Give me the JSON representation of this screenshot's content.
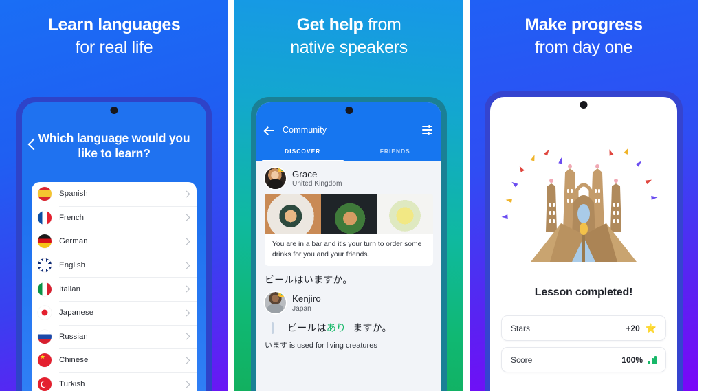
{
  "panels": [
    {
      "headline": {
        "bold": "Learn languages",
        "light": "",
        "line2": "for real life"
      },
      "screen": {
        "back_icon": "chevron-left-icon",
        "question": "Which language would you like to learn?",
        "languages": [
          {
            "name": "Spanish",
            "flag": "flag-spain"
          },
          {
            "name": "French",
            "flag": "flag-france"
          },
          {
            "name": "German",
            "flag": "flag-germany"
          },
          {
            "name": "English",
            "flag": "flag-uk"
          },
          {
            "name": "Italian",
            "flag": "flag-italy"
          },
          {
            "name": "Japanese",
            "flag": "flag-japan"
          },
          {
            "name": "Russian",
            "flag": "flag-russia"
          },
          {
            "name": "Chinese",
            "flag": "flag-china"
          },
          {
            "name": "Turkish",
            "flag": "flag-turkey"
          }
        ]
      }
    },
    {
      "headline": {
        "bold": "Get help",
        "light": " from",
        "line2": "native speakers"
      },
      "screen": {
        "back_icon": "arrow-left-icon",
        "title": "Community",
        "filter_icon": "sliders-icon",
        "tabs": [
          {
            "label": "DISCOVER",
            "active": true
          },
          {
            "label": "FRIENDS",
            "active": false
          }
        ],
        "post": {
          "author": "Grace",
          "location": "United Kingdom",
          "badge_icon": "crown-icon",
          "caption": "You are in a bar and it's your turn to order some drinks for you and your friends.",
          "body": "ビールはいますか。"
        },
        "reply": {
          "author": "Kenjiro",
          "location": "Japan",
          "badge_icon": "crown-icon",
          "correction_before": "ビールは",
          "correction_highlight": "あり",
          "correction_after": "ますか。",
          "note": "います is used for living creatures"
        }
      }
    },
    {
      "headline": {
        "bold": "Make progress",
        "light": "",
        "line2": "from day one"
      },
      "screen": {
        "illustration": "sagrada-familia-icon",
        "title": "Lesson completed!",
        "stats": [
          {
            "label": "Stars",
            "value": "+20",
            "icon": "star-icon"
          },
          {
            "label": "Score",
            "value": "100%",
            "icon": "bar-chart-icon"
          }
        ]
      }
    }
  ],
  "colors": {
    "panel1_start": "#1a6ef5",
    "panel1_end": "#6a16f5",
    "panel2_start": "#1797e8",
    "panel2_end": "#12b05f",
    "panel3_start": "#2060f5",
    "panel3_end": "#7a06f8",
    "app_blue": "#1676f0",
    "green_accent": "#18b869",
    "star_yellow": "#f5c518"
  }
}
